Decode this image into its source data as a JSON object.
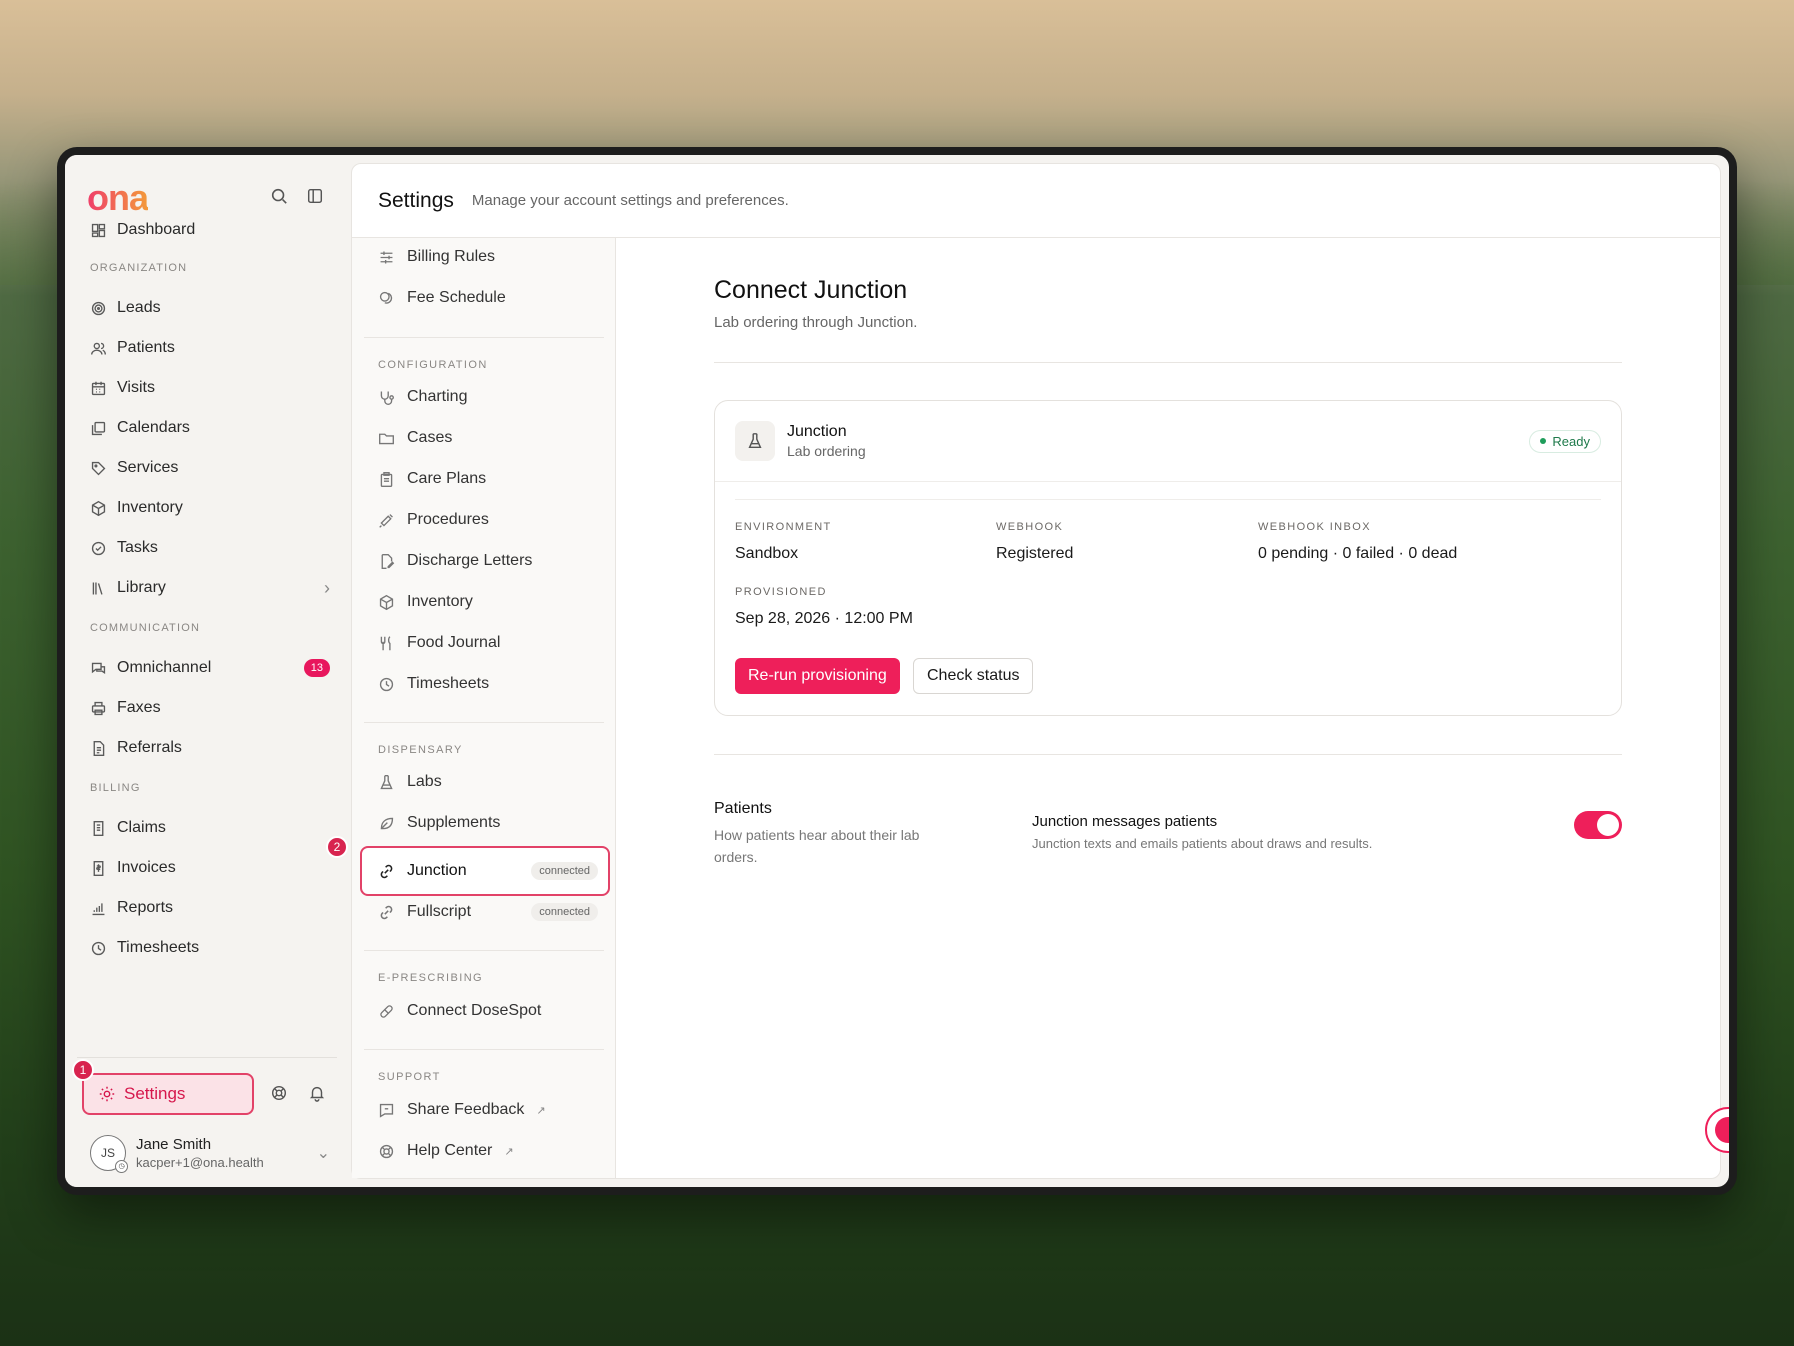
{
  "brand": {
    "logo": "ona",
    "accent": "#ee1f5a"
  },
  "sidebar": {
    "top_items": [
      {
        "label": "Dashboard",
        "icon": "dashboard-icon"
      }
    ],
    "sections": [
      {
        "label": "ORGANIZATION",
        "items": [
          {
            "label": "Leads",
            "icon": "target-icon"
          },
          {
            "label": "Patients",
            "icon": "users-icon"
          },
          {
            "label": "Visits",
            "icon": "calendar-grid-icon"
          },
          {
            "label": "Calendars",
            "icon": "calendars-icon"
          },
          {
            "label": "Services",
            "icon": "tag-icon"
          },
          {
            "label": "Inventory",
            "icon": "box-icon"
          },
          {
            "label": "Tasks",
            "icon": "check-circle-icon"
          },
          {
            "label": "Library",
            "icon": "library-icon"
          }
        ]
      },
      {
        "label": "COMMUNICATION",
        "items": [
          {
            "label": "Omnichannel",
            "icon": "chat-icon",
            "badge": "13"
          },
          {
            "label": "Faxes",
            "icon": "printer-icon"
          },
          {
            "label": "Referrals",
            "icon": "document-icon"
          }
        ]
      },
      {
        "label": "BILLING",
        "items": [
          {
            "label": "Claims",
            "icon": "document-icon"
          },
          {
            "label": "Invoices",
            "icon": "invoice-icon"
          },
          {
            "label": "Reports",
            "icon": "chart-icon"
          },
          {
            "label": "Timesheets",
            "icon": "clock-icon"
          }
        ]
      }
    ],
    "settings_label": "Settings",
    "step1": "1",
    "user": {
      "initials": "JS",
      "name": "Jane Smith",
      "email": "kacper+1@ona.health"
    }
  },
  "header": {
    "title": "Settings",
    "subtitle": "Manage your account settings and preferences."
  },
  "subnav": {
    "top_items": [
      {
        "label": "Billing Rules",
        "icon": "sliders-icon"
      },
      {
        "label": "Fee Schedule",
        "icon": "coins-icon"
      }
    ],
    "configuration_label": "CONFIGURATION",
    "configuration": [
      {
        "label": "Charting",
        "icon": "stethoscope-icon"
      },
      {
        "label": "Cases",
        "icon": "folder-icon"
      },
      {
        "label": "Care Plans",
        "icon": "clipboard-icon"
      },
      {
        "label": "Procedures",
        "icon": "syringe-icon"
      },
      {
        "label": "Discharge Letters",
        "icon": "file-edit-icon"
      },
      {
        "label": "Inventory",
        "icon": "box-icon"
      },
      {
        "label": "Food Journal",
        "icon": "utensils-icon"
      },
      {
        "label": "Timesheets",
        "icon": "clock-icon"
      }
    ],
    "dispensary_label": "DISPENSARY",
    "dispensary": [
      {
        "label": "Labs",
        "icon": "flask-icon"
      },
      {
        "label": "Supplements",
        "icon": "leaf-icon"
      },
      {
        "label": "Junction",
        "icon": "link-icon",
        "pill": "connected"
      },
      {
        "label": "Fullscript",
        "icon": "link-icon",
        "pill": "connected"
      }
    ],
    "eprescribing_label": "E-PRESCRIBING",
    "eprescribing": [
      {
        "label": "Connect DoseSpot",
        "icon": "pill-icon"
      }
    ],
    "support_label": "SUPPORT",
    "support": [
      {
        "label": "Share Feedback",
        "icon": "feedback-icon",
        "external": "↗"
      },
      {
        "label": "Help Center",
        "icon": "lifebuoy-icon",
        "external": "↗"
      }
    ],
    "step2": "2"
  },
  "content": {
    "title": "Connect Junction",
    "subtitle": "Lab ordering through Junction.",
    "card": {
      "name": "Junction",
      "desc": "Lab ordering",
      "status": "Ready",
      "environment_label": "ENVIRONMENT",
      "environment": "Sandbox",
      "webhook_label": "WEBHOOK",
      "webhook": "Registered",
      "inbox_label": "WEBHOOK INBOX",
      "inbox": "0 pending · 0 failed · 0 dead",
      "provisioned_label": "PROVISIONED",
      "provisioned": "Sep 28, 2026 · 12:00 PM",
      "rerun_label": "Re-run provisioning",
      "check_label": "Check status"
    },
    "patients": {
      "title": "Patients",
      "desc": "How patients hear about their lab orders.",
      "toggle_title": "Junction messages patients",
      "toggle_desc": "Junction texts and emails patients about draws and results.",
      "toggle_on": true
    }
  }
}
